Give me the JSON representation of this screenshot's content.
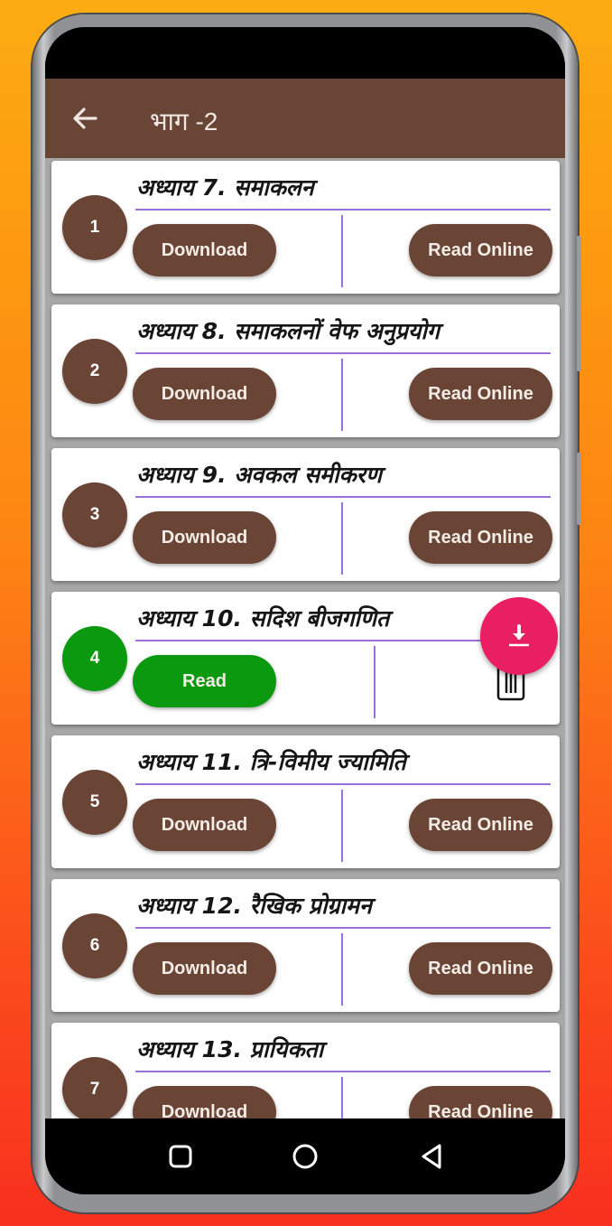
{
  "app_bar": {
    "title": "भाग -2",
    "back_icon": "arrow-left-icon"
  },
  "chapters": [
    {
      "number": "1",
      "title": "अध्याय 7. समाकलन",
      "state": "not-downloaded",
      "primary_label": "Download",
      "secondary_label": "Read Online"
    },
    {
      "number": "2",
      "title": "अध्याय 8. समाकलनों वेफ अनुप्रयोग",
      "state": "not-downloaded",
      "primary_label": "Download",
      "secondary_label": "Read Online"
    },
    {
      "number": "3",
      "title": "अध्याय 9. अवकल समीकरण",
      "state": "not-downloaded",
      "primary_label": "Download",
      "secondary_label": "Read Online"
    },
    {
      "number": "4",
      "title": "अध्याय 10. सदिश बीजगणित",
      "state": "downloaded",
      "primary_label": "Read",
      "secondary_icon": "trash-icon"
    },
    {
      "number": "5",
      "title": "अध्याय 11. त्रि-विमीय ज्यामिति",
      "state": "not-downloaded",
      "primary_label": "Download",
      "secondary_label": "Read Online"
    },
    {
      "number": "6",
      "title": "अध्याय 12.  रैखिक प्रोग्रामन",
      "state": "not-downloaded",
      "primary_label": "Download",
      "secondary_label": "Read Online"
    },
    {
      "number": "7",
      "title": "अध्याय 13. प्रायिकता",
      "state": "not-downloaded",
      "primary_label": "Download",
      "secondary_label": "Read Online"
    }
  ],
  "fab": {
    "icon": "download-icon"
  },
  "nav_bar": {
    "recents_icon": "square-icon",
    "home_icon": "circle-icon",
    "back_icon": "triangle-back-icon"
  },
  "colors": {
    "brand": "#694536",
    "downloaded": "#0b9a0f",
    "divider": "#9d6fdd",
    "fab": "#e91e63"
  }
}
